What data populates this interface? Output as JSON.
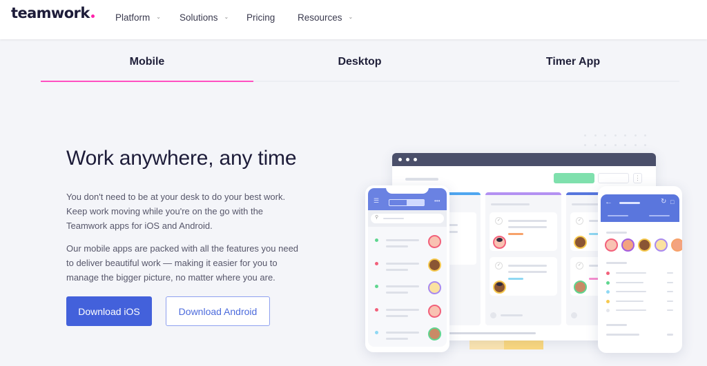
{
  "header": {
    "logo": "teamwork",
    "nav": [
      {
        "label": "Platform",
        "has_dropdown": true
      },
      {
        "label": "Solutions",
        "has_dropdown": true
      },
      {
        "label": "Pricing",
        "has_dropdown": false
      },
      {
        "label": "Resources",
        "has_dropdown": true
      }
    ],
    "dropdown_icon": "chevron-down-icon"
  },
  "tabs": {
    "items": [
      {
        "label": "Mobile",
        "active": true
      },
      {
        "label": "Desktop",
        "active": false
      },
      {
        "label": "Timer App",
        "active": false
      }
    ],
    "active_color": "#ff4fc1"
  },
  "hero": {
    "title": "Work anywhere, any time",
    "paragraph1": [
      "You don't need to be at your desk to do your best work.",
      "Keep work moving while you're on the go with the",
      "Teamwork apps for iOS and Android."
    ],
    "paragraph2": [
      "Our mobile apps are packed with all the features you need",
      "to deliver beautiful work — making it easier for you to",
      "manage the bigger picture, no matter where you are."
    ],
    "buttons": {
      "ios": "Download iOS",
      "android": "Download Android"
    }
  },
  "colors": {
    "brand_blue": "#4361db",
    "brand_pink": "#ff22aa",
    "window_bar": "#4a4f6a",
    "status_green": "#5fd68f",
    "status_red": "#f2607a",
    "status_cyan": "#8fd8f3",
    "status_yellow": "#f6c94f"
  },
  "illustration": {
    "desc": "mockup of Teamwork apps on desktop and mobile devices",
    "icons": [
      "menu-icon",
      "search-icon",
      "more-icon",
      "back-arrow-icon",
      "refresh-icon",
      "bookmark-icon",
      "check-icon",
      "add-icon"
    ]
  }
}
